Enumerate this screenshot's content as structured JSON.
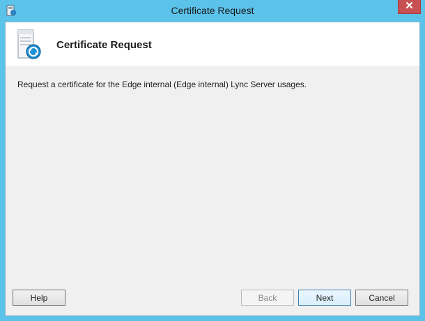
{
  "window": {
    "title": "Certificate Request",
    "close_glyph": "✕"
  },
  "header": {
    "title": "Certificate Request",
    "icon": "certificate-server-icon"
  },
  "main": {
    "description": "Request a certificate for the Edge internal (Edge internal) Lync Server usages."
  },
  "buttons": {
    "help": "Help",
    "back": "Back",
    "next": "Next",
    "cancel": "Cancel"
  },
  "colors": {
    "frame": "#5bc2ea",
    "close": "#c75050",
    "body": "#f0f0f0"
  }
}
